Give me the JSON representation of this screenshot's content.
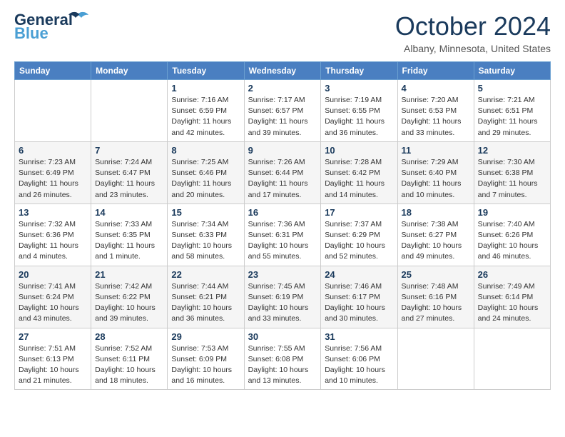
{
  "header": {
    "logo_line1": "General",
    "logo_line2": "Blue",
    "month": "October 2024",
    "location": "Albany, Minnesota, United States"
  },
  "days_of_week": [
    "Sunday",
    "Monday",
    "Tuesday",
    "Wednesday",
    "Thursday",
    "Friday",
    "Saturday"
  ],
  "weeks": [
    [
      {
        "day": "",
        "sunrise": "",
        "sunset": "",
        "daylight": ""
      },
      {
        "day": "",
        "sunrise": "",
        "sunset": "",
        "daylight": ""
      },
      {
        "day": "1",
        "sunrise": "Sunrise: 7:16 AM",
        "sunset": "Sunset: 6:59 PM",
        "daylight": "Daylight: 11 hours and 42 minutes."
      },
      {
        "day": "2",
        "sunrise": "Sunrise: 7:17 AM",
        "sunset": "Sunset: 6:57 PM",
        "daylight": "Daylight: 11 hours and 39 minutes."
      },
      {
        "day": "3",
        "sunrise": "Sunrise: 7:19 AM",
        "sunset": "Sunset: 6:55 PM",
        "daylight": "Daylight: 11 hours and 36 minutes."
      },
      {
        "day": "4",
        "sunrise": "Sunrise: 7:20 AM",
        "sunset": "Sunset: 6:53 PM",
        "daylight": "Daylight: 11 hours and 33 minutes."
      },
      {
        "day": "5",
        "sunrise": "Sunrise: 7:21 AM",
        "sunset": "Sunset: 6:51 PM",
        "daylight": "Daylight: 11 hours and 29 minutes."
      }
    ],
    [
      {
        "day": "6",
        "sunrise": "Sunrise: 7:23 AM",
        "sunset": "Sunset: 6:49 PM",
        "daylight": "Daylight: 11 hours and 26 minutes."
      },
      {
        "day": "7",
        "sunrise": "Sunrise: 7:24 AM",
        "sunset": "Sunset: 6:47 PM",
        "daylight": "Daylight: 11 hours and 23 minutes."
      },
      {
        "day": "8",
        "sunrise": "Sunrise: 7:25 AM",
        "sunset": "Sunset: 6:46 PM",
        "daylight": "Daylight: 11 hours and 20 minutes."
      },
      {
        "day": "9",
        "sunrise": "Sunrise: 7:26 AM",
        "sunset": "Sunset: 6:44 PM",
        "daylight": "Daylight: 11 hours and 17 minutes."
      },
      {
        "day": "10",
        "sunrise": "Sunrise: 7:28 AM",
        "sunset": "Sunset: 6:42 PM",
        "daylight": "Daylight: 11 hours and 14 minutes."
      },
      {
        "day": "11",
        "sunrise": "Sunrise: 7:29 AM",
        "sunset": "Sunset: 6:40 PM",
        "daylight": "Daylight: 11 hours and 10 minutes."
      },
      {
        "day": "12",
        "sunrise": "Sunrise: 7:30 AM",
        "sunset": "Sunset: 6:38 PM",
        "daylight": "Daylight: 11 hours and 7 minutes."
      }
    ],
    [
      {
        "day": "13",
        "sunrise": "Sunrise: 7:32 AM",
        "sunset": "Sunset: 6:36 PM",
        "daylight": "Daylight: 11 hours and 4 minutes."
      },
      {
        "day": "14",
        "sunrise": "Sunrise: 7:33 AM",
        "sunset": "Sunset: 6:35 PM",
        "daylight": "Daylight: 11 hours and 1 minute."
      },
      {
        "day": "15",
        "sunrise": "Sunrise: 7:34 AM",
        "sunset": "Sunset: 6:33 PM",
        "daylight": "Daylight: 10 hours and 58 minutes."
      },
      {
        "day": "16",
        "sunrise": "Sunrise: 7:36 AM",
        "sunset": "Sunset: 6:31 PM",
        "daylight": "Daylight: 10 hours and 55 minutes."
      },
      {
        "day": "17",
        "sunrise": "Sunrise: 7:37 AM",
        "sunset": "Sunset: 6:29 PM",
        "daylight": "Daylight: 10 hours and 52 minutes."
      },
      {
        "day": "18",
        "sunrise": "Sunrise: 7:38 AM",
        "sunset": "Sunset: 6:27 PM",
        "daylight": "Daylight: 10 hours and 49 minutes."
      },
      {
        "day": "19",
        "sunrise": "Sunrise: 7:40 AM",
        "sunset": "Sunset: 6:26 PM",
        "daylight": "Daylight: 10 hours and 46 minutes."
      }
    ],
    [
      {
        "day": "20",
        "sunrise": "Sunrise: 7:41 AM",
        "sunset": "Sunset: 6:24 PM",
        "daylight": "Daylight: 10 hours and 43 minutes."
      },
      {
        "day": "21",
        "sunrise": "Sunrise: 7:42 AM",
        "sunset": "Sunset: 6:22 PM",
        "daylight": "Daylight: 10 hours and 39 minutes."
      },
      {
        "day": "22",
        "sunrise": "Sunrise: 7:44 AM",
        "sunset": "Sunset: 6:21 PM",
        "daylight": "Daylight: 10 hours and 36 minutes."
      },
      {
        "day": "23",
        "sunrise": "Sunrise: 7:45 AM",
        "sunset": "Sunset: 6:19 PM",
        "daylight": "Daylight: 10 hours and 33 minutes."
      },
      {
        "day": "24",
        "sunrise": "Sunrise: 7:46 AM",
        "sunset": "Sunset: 6:17 PM",
        "daylight": "Daylight: 10 hours and 30 minutes."
      },
      {
        "day": "25",
        "sunrise": "Sunrise: 7:48 AM",
        "sunset": "Sunset: 6:16 PM",
        "daylight": "Daylight: 10 hours and 27 minutes."
      },
      {
        "day": "26",
        "sunrise": "Sunrise: 7:49 AM",
        "sunset": "Sunset: 6:14 PM",
        "daylight": "Daylight: 10 hours and 24 minutes."
      }
    ],
    [
      {
        "day": "27",
        "sunrise": "Sunrise: 7:51 AM",
        "sunset": "Sunset: 6:13 PM",
        "daylight": "Daylight: 10 hours and 21 minutes."
      },
      {
        "day": "28",
        "sunrise": "Sunrise: 7:52 AM",
        "sunset": "Sunset: 6:11 PM",
        "daylight": "Daylight: 10 hours and 18 minutes."
      },
      {
        "day": "29",
        "sunrise": "Sunrise: 7:53 AM",
        "sunset": "Sunset: 6:09 PM",
        "daylight": "Daylight: 10 hours and 16 minutes."
      },
      {
        "day": "30",
        "sunrise": "Sunrise: 7:55 AM",
        "sunset": "Sunset: 6:08 PM",
        "daylight": "Daylight: 10 hours and 13 minutes."
      },
      {
        "day": "31",
        "sunrise": "Sunrise: 7:56 AM",
        "sunset": "Sunset: 6:06 PM",
        "daylight": "Daylight: 10 hours and 10 minutes."
      },
      {
        "day": "",
        "sunrise": "",
        "sunset": "",
        "daylight": ""
      },
      {
        "day": "",
        "sunrise": "",
        "sunset": "",
        "daylight": ""
      }
    ]
  ]
}
